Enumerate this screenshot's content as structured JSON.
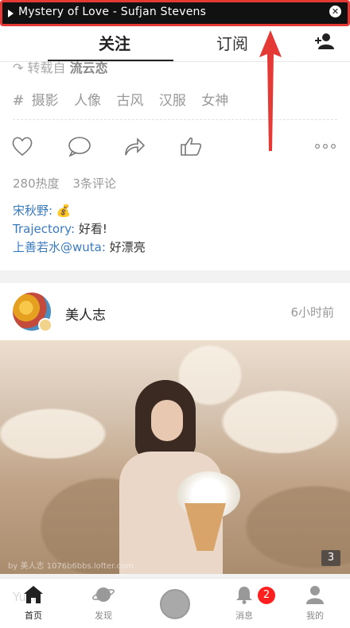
{
  "music_bar": {
    "title": "Mystery of Love - Sufjan Stevens",
    "close_glyph": "✕"
  },
  "top_nav": {
    "tabs": [
      {
        "label": "关注"
      },
      {
        "label": "订阅"
      }
    ]
  },
  "post1": {
    "repost_prefix": "转载自",
    "repost_source": "流云恋",
    "tags": [
      "摄影",
      "人像",
      "古风",
      "汉服",
      "女神"
    ],
    "heat": "280热度",
    "comments_count": "3条评论",
    "comments": [
      {
        "user": "宋秋野:",
        "text": "💰"
      },
      {
        "user": "Trajectory:",
        "text": "好看!"
      },
      {
        "user": "上善若水@wuta:",
        "text": "好漂亮"
      }
    ]
  },
  "post2": {
    "author": "美人志",
    "time": "6小时前",
    "image_count": "3",
    "watermark": "by 美人志 1076b6bbs.lofter.com",
    "ghost_text": "Yuzi"
  },
  "bottom_nav": {
    "items": [
      {
        "label": "首页"
      },
      {
        "label": "发现"
      },
      {
        "label": "消息"
      },
      {
        "label": "我的"
      }
    ],
    "messages_badge": "2"
  },
  "colors": {
    "annotation_red": "#e53935",
    "link_blue": "#3a7bbf",
    "badge_red": "#ff1f1f"
  }
}
